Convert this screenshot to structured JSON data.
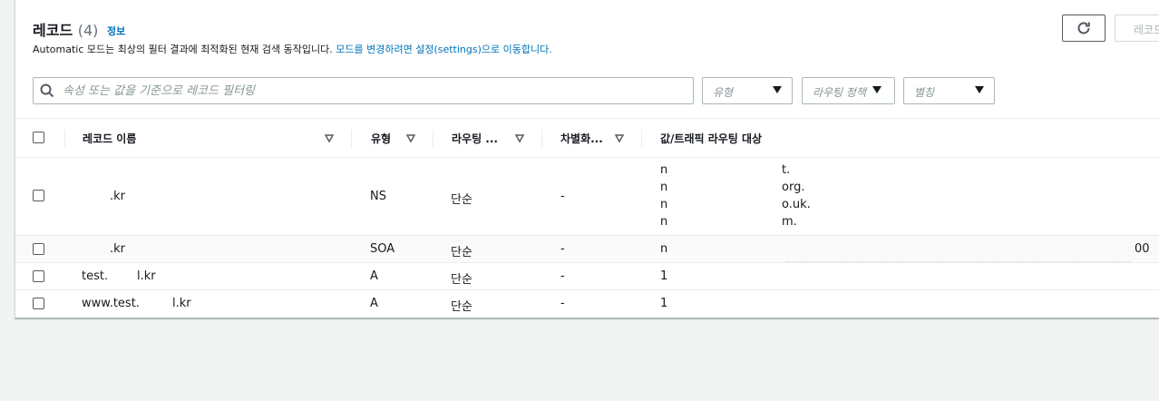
{
  "header": {
    "title": "레코드",
    "count": "(4)",
    "info_link": "정보",
    "description": "Automatic 모드는 최상의 필터 결과에 최적화된 현재 검색 동작입니다. ",
    "description_link": "모드를 변경하려면 설정(settings)으로 이동합니다.",
    "create_button": "레코드 생성"
  },
  "search": {
    "placeholder": "속성 또는 값을 기준으로 레코드 필터링"
  },
  "filters": {
    "type": "유형",
    "routing_policy": "라우팅 정책",
    "alias": "별칭"
  },
  "table": {
    "columns": [
      "레코드 이름",
      "유형",
      "라우팅 ...",
      "차별화...",
      "값/트래픽 라우팅 대상"
    ],
    "rows": [
      {
        "name": ".kr",
        "type": "NS",
        "routing": "단순",
        "diff": "-",
        "values": [
          "n",
          "n",
          "n",
          "n"
        ],
        "value_tails": [
          "t.",
          "org.",
          "o.uk.",
          "m."
        ]
      },
      {
        "name": ".kr",
        "type": "SOA",
        "routing": "단순",
        "diff": "-",
        "values": [
          "n"
        ],
        "value_tails": [
          "00"
        ]
      },
      {
        "name_prefix": "test.",
        "name": "l.kr",
        "type": "A",
        "routing": "단순",
        "diff": "-",
        "values": [
          "1"
        ]
      },
      {
        "name_prefix": "www.test.",
        "name": "l.kr",
        "type": "A",
        "routing": "단순",
        "diff": "-",
        "values": [
          "1"
        ]
      }
    ]
  },
  "colors": {
    "link": "#0073bb",
    "border": "#aab7b8"
  }
}
